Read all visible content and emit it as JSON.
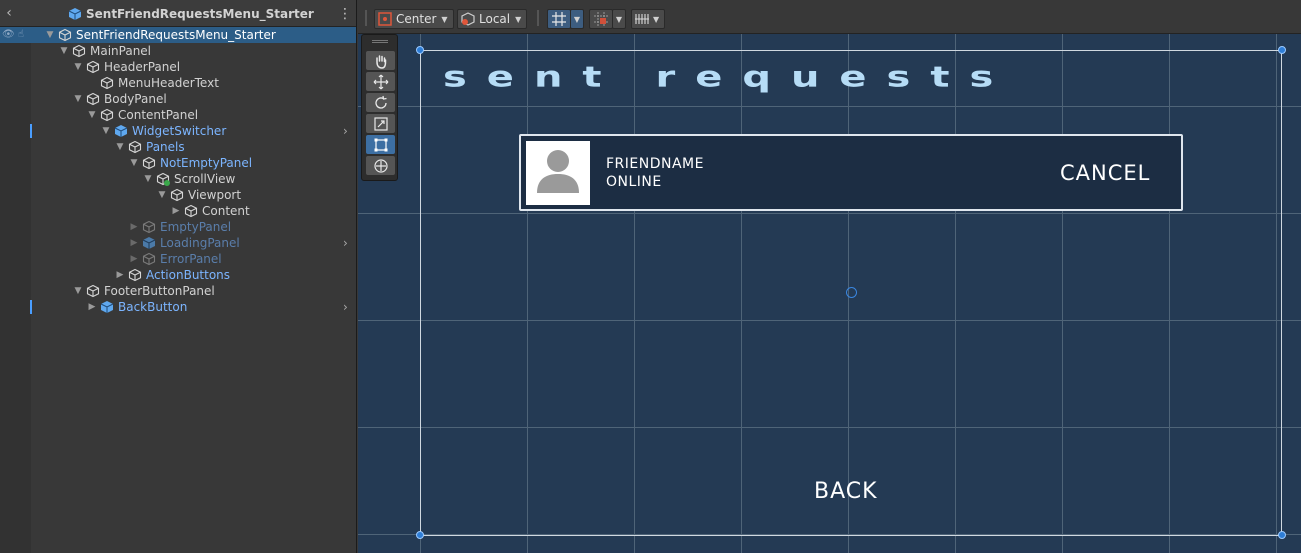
{
  "hierarchy": {
    "title": "SentFriendRequestsMenu_Starter",
    "rows": [
      {
        "label": "SentFriendRequestsMenu_Starter"
      },
      {
        "label": "MainPanel"
      },
      {
        "label": "HeaderPanel"
      },
      {
        "label": "MenuHeaderText"
      },
      {
        "label": "BodyPanel"
      },
      {
        "label": "ContentPanel"
      },
      {
        "label": "WidgetSwitcher"
      },
      {
        "label": "Panels"
      },
      {
        "label": "NotEmptyPanel"
      },
      {
        "label": "ScrollView"
      },
      {
        "label": "Viewport"
      },
      {
        "label": "Content"
      },
      {
        "label": "EmptyPanel"
      },
      {
        "label": "LoadingPanel"
      },
      {
        "label": "ErrorPanel"
      },
      {
        "label": "ActionButtons"
      },
      {
        "label": "FooterButtonPanel"
      },
      {
        "label": "BackButton"
      }
    ]
  },
  "scene_toolbar": {
    "pivot_mode": "Center",
    "pivot_rotation": "Local"
  },
  "scene": {
    "header_text": "sent requests",
    "friend_name": "FRIENDNAME",
    "friend_status": "ONLINE",
    "cancel_label": "CANCEL",
    "back_label": "BACK"
  },
  "colors": {
    "scene_background": "#243a54",
    "title_text": "#b6dcf6",
    "card_background": "#1c2d43",
    "selection": "#2c5d87",
    "prefab_text": "#7cb5ff"
  }
}
